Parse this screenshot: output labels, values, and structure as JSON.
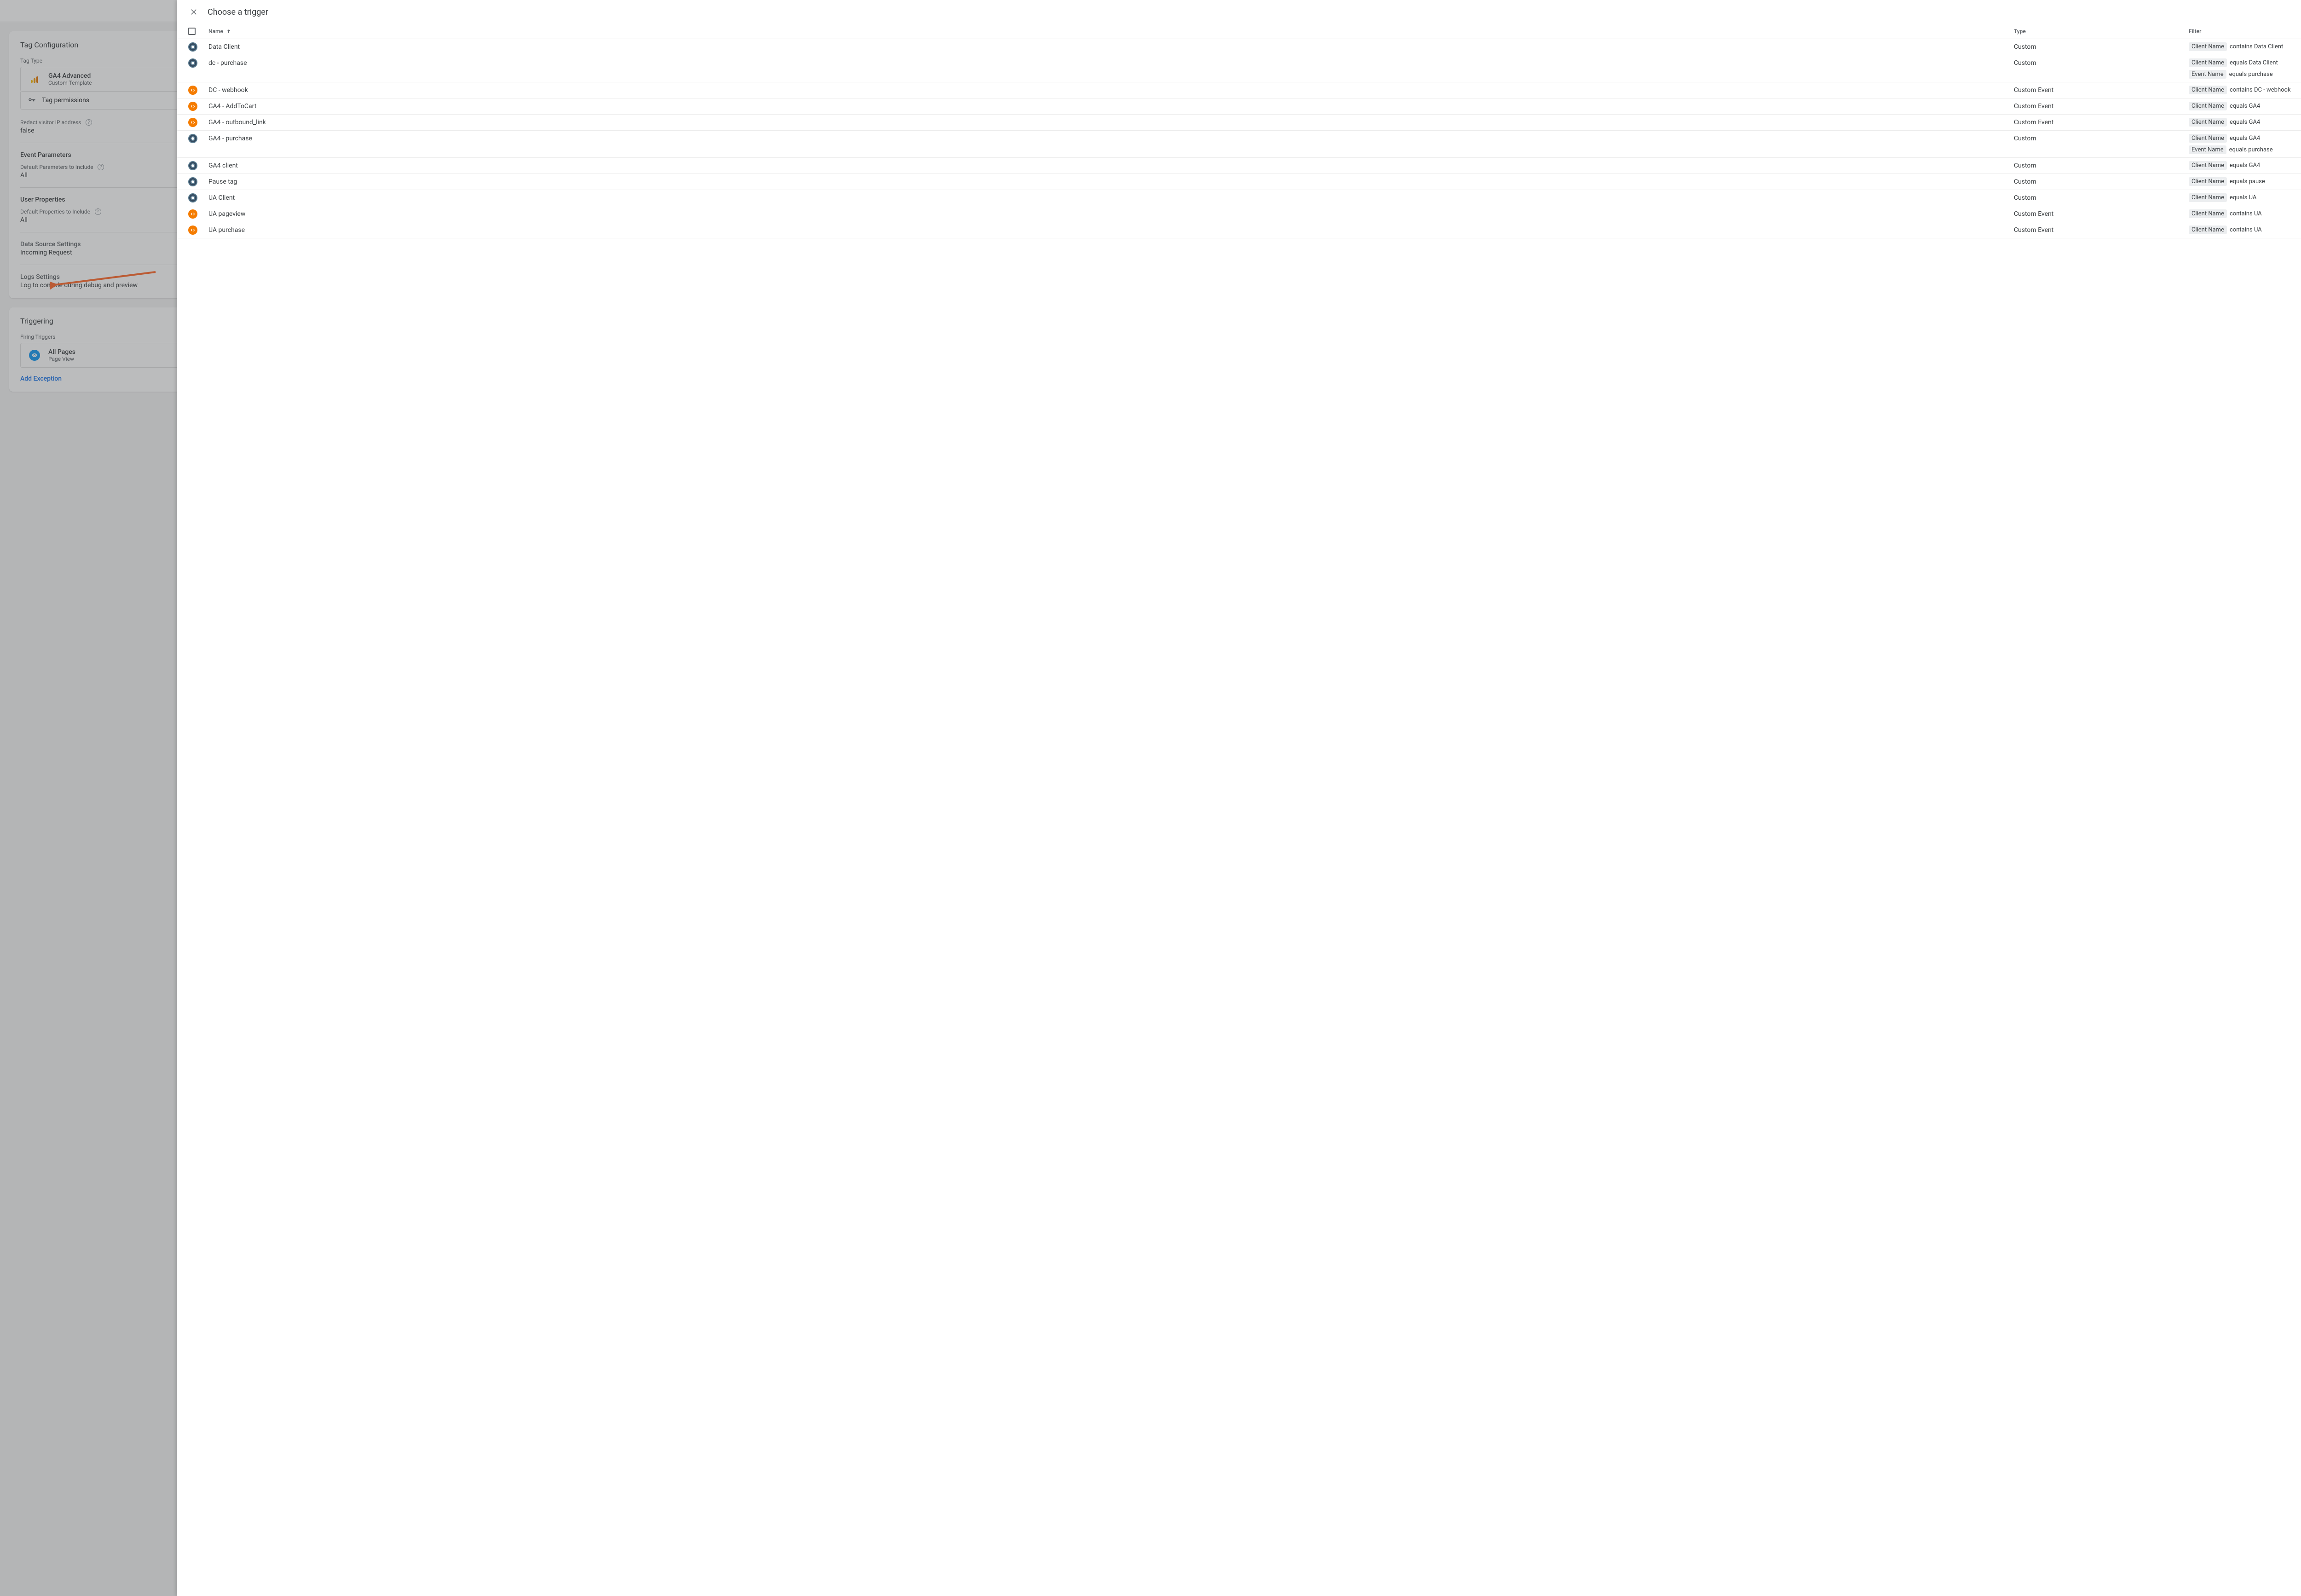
{
  "tagConfig": {
    "title": "Tag Configuration",
    "tagTypeLabel": "Tag Type",
    "tagName": "GA4 Advanced",
    "tagSub": "Custom Template",
    "permissions": "Tag permissions",
    "redactLabel": "Redact visitor IP address",
    "redactValue": "false",
    "eventParamsTitle": "Event Parameters",
    "defaultParamsLabel": "Default Parameters to Include",
    "defaultParamsValue": "All",
    "userPropsTitle": "User Properties",
    "defaultPropsLabel": "Default Properties to Include",
    "defaultPropsValue": "All",
    "dataSourceTitle": "Data Source Settings",
    "dataSourceValue": "Incoming Request",
    "logsTitle": "Logs Settings",
    "logsValue": "Log to console during debug and preview"
  },
  "triggering": {
    "title": "Triggering",
    "firingLabel": "Firing Triggers",
    "triggerName": "All Pages",
    "triggerSub": "Page View",
    "addException": "Add Exception"
  },
  "panel": {
    "title": "Choose a trigger",
    "columns": {
      "name": "Name",
      "type": "Type",
      "filter": "Filter"
    }
  },
  "rows": [
    {
      "name": "Data Client",
      "type": "Custom",
      "icon": "custom",
      "filters": [
        {
          "k": "Client Name",
          "v": "contains Data Client"
        }
      ]
    },
    {
      "name": "dc - purchase",
      "type": "Custom",
      "icon": "custom",
      "filters": [
        {
          "k": "Client Name",
          "v": "equals Data Client"
        },
        {
          "k": "Event Name",
          "v": "equals purchase"
        }
      ]
    },
    {
      "name": "DC - webhook",
      "type": "Custom Event",
      "icon": "event",
      "filters": [
        {
          "k": "Client Name",
          "v": "contains DC - webhook"
        }
      ]
    },
    {
      "name": "GA4 - AddToCart",
      "type": "Custom Event",
      "icon": "event",
      "filters": [
        {
          "k": "Client Name",
          "v": "equals GA4"
        }
      ]
    },
    {
      "name": "GA4 - outbound_link",
      "type": "Custom Event",
      "icon": "event",
      "filters": [
        {
          "k": "Client Name",
          "v": "equals GA4"
        }
      ]
    },
    {
      "name": "GA4 - purchase",
      "type": "Custom",
      "icon": "custom",
      "filters": [
        {
          "k": "Client Name",
          "v": "equals GA4"
        },
        {
          "k": "Event Name",
          "v": "equals purchase"
        }
      ]
    },
    {
      "name": "GA4 client",
      "type": "Custom",
      "icon": "custom",
      "filters": [
        {
          "k": "Client Name",
          "v": "equals GA4"
        }
      ]
    },
    {
      "name": "Pause tag",
      "type": "Custom",
      "icon": "custom",
      "filters": [
        {
          "k": "Client Name",
          "v": "equals pause"
        }
      ]
    },
    {
      "name": "UA Client",
      "type": "Custom",
      "icon": "custom",
      "filters": [
        {
          "k": "Client Name",
          "v": "equals UA"
        }
      ]
    },
    {
      "name": "UA pageview",
      "type": "Custom Event",
      "icon": "event",
      "filters": [
        {
          "k": "Client Name",
          "v": "contains UA"
        }
      ]
    },
    {
      "name": "UA purchase",
      "type": "Custom Event",
      "icon": "event",
      "filters": [
        {
          "k": "Client Name",
          "v": "contains UA"
        }
      ]
    }
  ]
}
